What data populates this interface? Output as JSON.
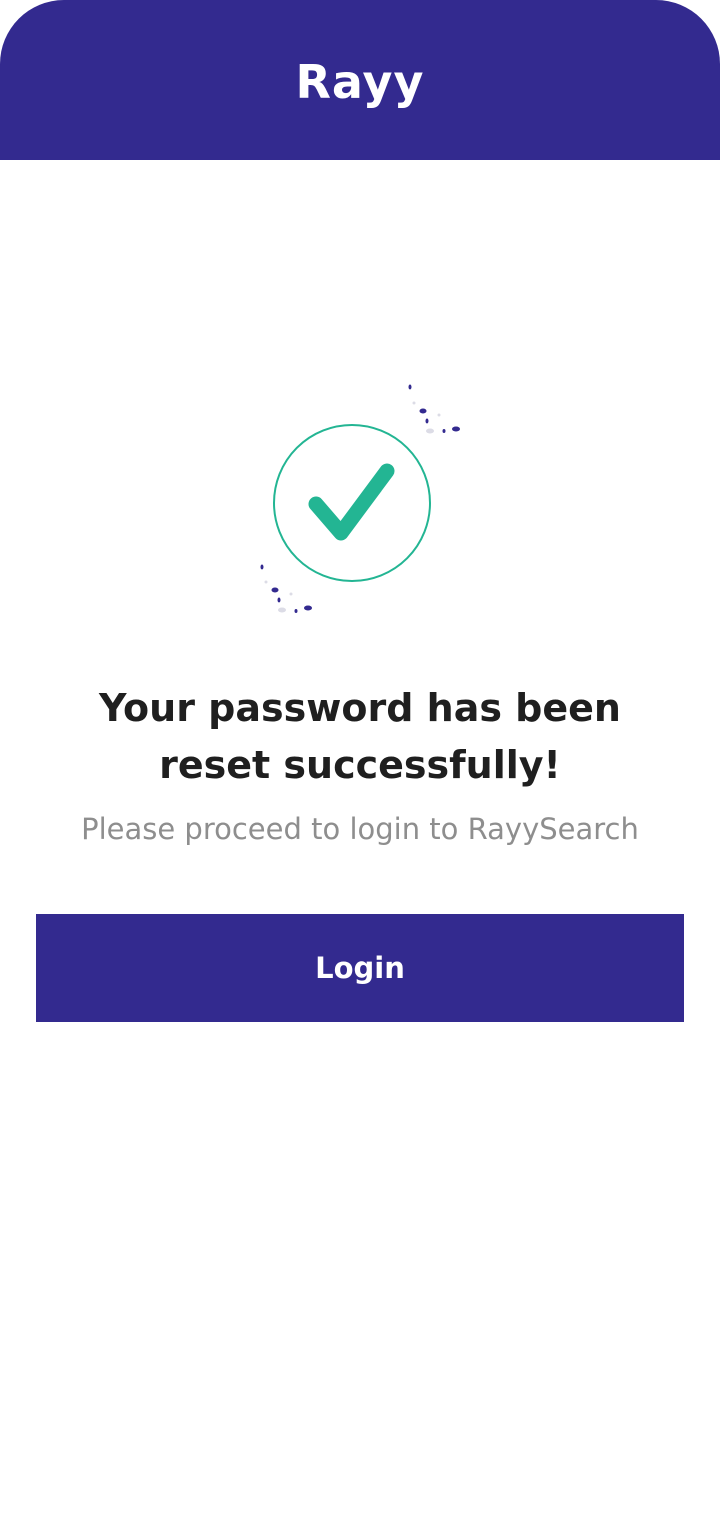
{
  "header": {
    "brand": "Rayy",
    "background_color": "#332a8f"
  },
  "illustration": {
    "icon": "success-checkmark-icon",
    "check_color": "#23b593",
    "dot_color": "#332a8f"
  },
  "message": {
    "title_line1": "Your password has been",
    "title_line2": "reset successfully!",
    "subtitle": "Please proceed to login to RayySearch"
  },
  "actions": {
    "login_label": "Login",
    "button_color": "#332a8f"
  }
}
